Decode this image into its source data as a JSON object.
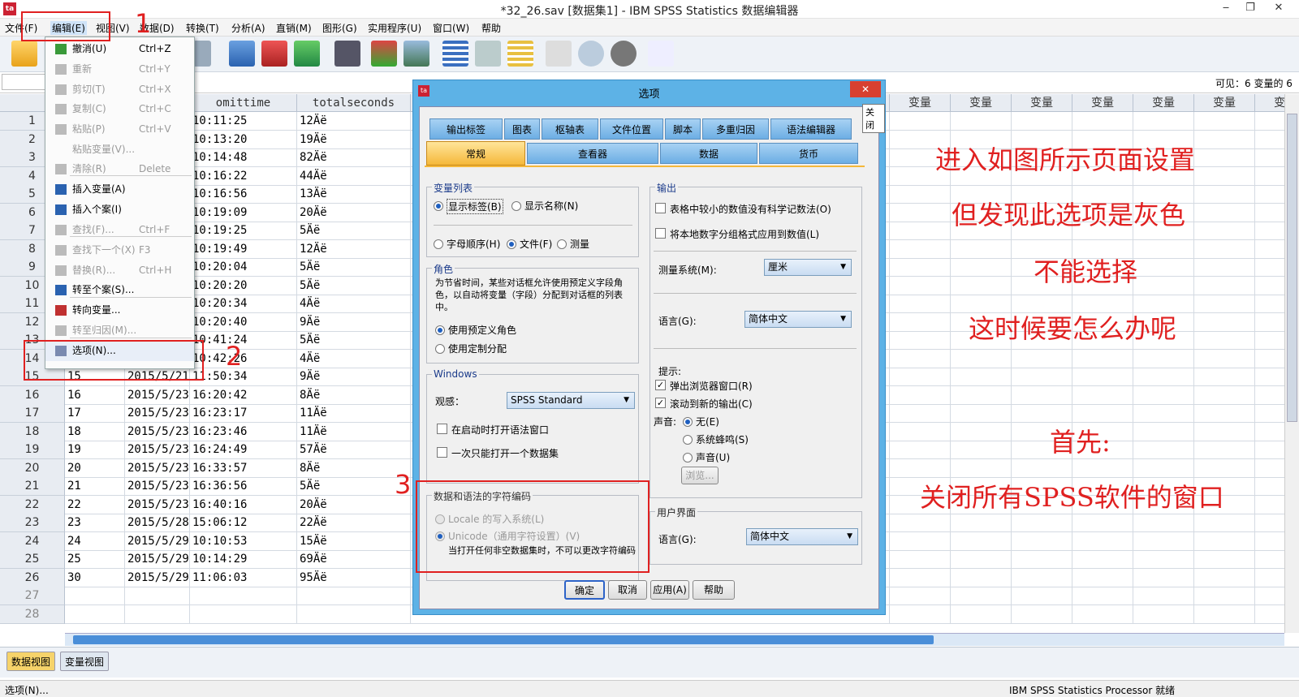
{
  "window": {
    "title": "*32_26.sav [数据集1] - IBM SPSS Statistics 数据编辑器",
    "app_icon": "spss-icon"
  },
  "menubar": [
    "文件(F)",
    "编辑(E)",
    "视图(V)",
    "数据(D)",
    "转换(T)",
    "分析(A)",
    "直销(M)",
    "图形(G)",
    "实用程序(U)",
    "窗口(W)",
    "帮助"
  ],
  "info": {
    "visible": "可见：6 变量的 6"
  },
  "grid": {
    "headers": [
      "",
      "",
      "omittime",
      "totalseconds"
    ],
    "var_header": "变量",
    "rows": [
      [
        "1",
        "",
        "",
        "10:11:25",
        "12Äë"
      ],
      [
        "2",
        "",
        "",
        "10:13:20",
        "19Äë"
      ],
      [
        "3",
        "",
        "",
        "10:14:48",
        "82Äë"
      ],
      [
        "4",
        "",
        "",
        "10:16:22",
        "44Äë"
      ],
      [
        "5",
        "",
        "",
        "10:16:56",
        "13Äë"
      ],
      [
        "6",
        "",
        "",
        "10:19:09",
        "20Äë"
      ],
      [
        "7",
        "",
        "",
        "10:19:25",
        "5Äë"
      ],
      [
        "8",
        "",
        "",
        "10:19:49",
        "12Äë"
      ],
      [
        "9",
        "",
        "",
        "10:20:04",
        "5Äë"
      ],
      [
        "10",
        "",
        "",
        "10:20:20",
        "5Äë"
      ],
      [
        "11",
        "",
        "",
        "10:20:34",
        "4Äë"
      ],
      [
        "12",
        "",
        "",
        "10:20:40",
        "9Äë"
      ],
      [
        "13",
        "",
        "",
        "10:41:24",
        "5Äë"
      ],
      [
        "14",
        "",
        "",
        "10:42:26",
        "4Äë"
      ],
      [
        "15",
        "15",
        "2015/5/21",
        "11:50:34",
        "9Äë"
      ],
      [
        "16",
        "16",
        "2015/5/23",
        "16:20:42",
        "8Äë"
      ],
      [
        "17",
        "17",
        "2015/5/23",
        "16:23:17",
        "11Äë"
      ],
      [
        "18",
        "18",
        "2015/5/23",
        "16:23:46",
        "11Äë"
      ],
      [
        "19",
        "19",
        "2015/5/23",
        "16:24:49",
        "57Äë"
      ],
      [
        "20",
        "20",
        "2015/5/23",
        "16:33:57",
        "8Äë"
      ],
      [
        "21",
        "21",
        "2015/5/23",
        "16:36:56",
        "5Äë"
      ],
      [
        "22",
        "22",
        "2015/5/23",
        "16:40:16",
        "20Äë"
      ],
      [
        "23",
        "23",
        "2015/5/28",
        "15:06:12",
        "22Äë"
      ],
      [
        "24",
        "24",
        "2015/5/29",
        "10:10:53",
        "15Äë"
      ],
      [
        "25",
        "25",
        "2015/5/29",
        "10:14:29",
        "69Äë"
      ],
      [
        "26",
        "30",
        "2015/5/29",
        "11:06:03",
        "95Äë"
      ],
      [
        "27",
        "",
        "",
        "",
        ""
      ],
      [
        "28",
        "",
        "",
        "",
        ""
      ]
    ]
  },
  "edit_menu": [
    {
      "label": "撤消(U)",
      "shortcut": "Ctrl+Z",
      "enabled": true,
      "icon": "undo-icon"
    },
    {
      "label": "重新",
      "shortcut": "Ctrl+Y",
      "enabled": false,
      "icon": "redo-icon"
    },
    {
      "label": "剪切(T)",
      "shortcut": "Ctrl+X",
      "enabled": false,
      "icon": "cut-icon"
    },
    {
      "label": "复制(C)",
      "shortcut": "Ctrl+C",
      "enabled": false,
      "icon": "copy-icon"
    },
    {
      "label": "粘贴(P)",
      "shortcut": "Ctrl+V",
      "enabled": false,
      "icon": "paste-icon"
    },
    {
      "label": "粘贴变量(V)...",
      "shortcut": "",
      "enabled": false,
      "icon": ""
    },
    {
      "label": "清除(R)",
      "shortcut": "Delete",
      "enabled": false,
      "icon": "clear-icon"
    },
    {
      "label": "插入变量(A)",
      "shortcut": "",
      "enabled": true,
      "icon": "insert-variable-icon"
    },
    {
      "label": "插入个案(I)",
      "shortcut": "",
      "enabled": true,
      "icon": "insert-case-icon"
    },
    {
      "label": "查找(F)...",
      "shortcut": "Ctrl+F",
      "enabled": false,
      "icon": "find-icon"
    },
    {
      "label": "查找下一个(X)",
      "shortcut": "F3",
      "enabled": false,
      "icon": "find-next-icon"
    },
    {
      "label": "替换(R)...",
      "shortcut": "Ctrl+H",
      "enabled": false,
      "icon": "replace-icon"
    },
    {
      "label": "转至个案(S)...",
      "shortcut": "",
      "enabled": true,
      "icon": "goto-case-icon"
    },
    {
      "label": "转向变量...",
      "shortcut": "",
      "enabled": true,
      "icon": "goto-variable-icon"
    },
    {
      "label": "转至归因(M)...",
      "shortcut": "",
      "enabled": false,
      "icon": "goto-imputation-icon"
    },
    {
      "label": "选项(N)...",
      "shortcut": "",
      "enabled": true,
      "icon": "options-icon"
    }
  ],
  "dialog": {
    "title": "选项",
    "close_tooltip": "关闭",
    "tabs_row1": [
      "输出标签",
      "图表",
      "枢轴表",
      "文件位置",
      "脚本",
      "多重归因",
      "语法编辑器"
    ],
    "tabs_row2": [
      "常规",
      "查看器",
      "数据",
      "货币"
    ],
    "var_list": {
      "title": "变量列表",
      "opt1": "显示标签(B)",
      "opt2": "显示名称(N)",
      "opt3": "字母顺序(H)",
      "opt4": "文件(F)",
      "opt5": "测量"
    },
    "roles": {
      "title": "角色",
      "desc": "为节省时间，某些对话框允许使用预定义字段角色，以自动将变量（字段）分配到对话框的列表中。",
      "opt1": "使用预定义角色",
      "opt2": "使用定制分配"
    },
    "windows": {
      "title": "Windows",
      "look_label": "观感：",
      "look_value": "SPSS Standard",
      "chk1": "在启动时打开语法窗口",
      "chk2": "一次只能打开一个数据集"
    },
    "encoding": {
      "title": "数据和语法的字符编码",
      "opt1": "Locale 的写入系统(L)",
      "opt2": "Unicode（通用字符设置）(V)",
      "note": "当打开任何非空数据集时，不可以更改字符编码"
    },
    "output": {
      "title": "输出",
      "chk1": "表格中较小的数值没有科学记数法(O)",
      "chk2": "将本地数字分组格式应用到数值(L)",
      "measure_label": "测量系统(M):",
      "measure_value": "厘米",
      "lang_label": "语言(G):",
      "lang_value": "简体中文",
      "notify_label": "提示:",
      "chk3": "弹出浏览器窗口(R)",
      "chk4": "滚动到新的输出(C)",
      "sound_label": "声音:",
      "sound1": "无(E)",
      "sound2": "系统蜂鸣(S)",
      "sound3": "声音(U)",
      "browse": "浏览..."
    },
    "ui": {
      "title": "用户界面",
      "lang_label": "语言(G):",
      "lang_value": "简体中文"
    },
    "buttons": {
      "ok": "确定",
      "cancel": "取消",
      "apply": "应用(A)",
      "help": "帮助"
    }
  },
  "bottom_tabs": {
    "data_view": "数据视图",
    "var_view": "变量视图"
  },
  "status": {
    "left": "选项(N)...",
    "right": "IBM SPSS Statistics Processor 就绪"
  },
  "annotations": {
    "num1": "1",
    "num2": "2",
    "num3": "3",
    "lines": [
      "进入如图所示页面设置",
      "但发现此选项是灰色",
      "不能选择",
      "这时候要怎么办呢",
      "首先:",
      "关闭所有SPSS软件的窗口"
    ],
    "color": "#e02020"
  }
}
